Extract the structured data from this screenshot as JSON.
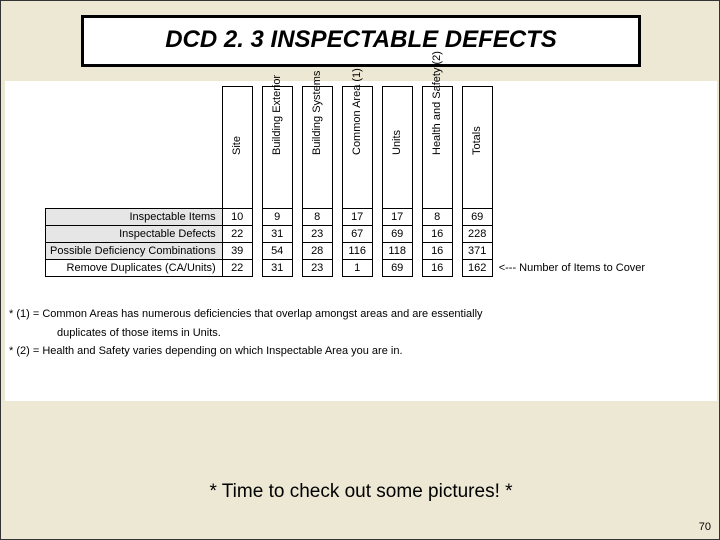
{
  "title": "DCD 2. 3 INSPECTABLE DEFECTS",
  "columns": [
    "Site",
    "Building Exterior",
    "Building Systems",
    "Common Area (1)",
    "Units",
    "Health and Safety (2)"
  ],
  "totals_header": "Totals",
  "rows": [
    {
      "label": "Inspectable Items",
      "bg": "grey",
      "cells": [
        "10",
        "9",
        "8",
        "17",
        "17",
        "8"
      ],
      "total": "69"
    },
    {
      "label": "Inspectable Defects",
      "bg": "grey",
      "cells": [
        "22",
        "31",
        "23",
        "67",
        "69",
        "16"
      ],
      "total": "228"
    },
    {
      "label": "Possible Deficiency Combinations",
      "bg": "grey",
      "cells": [
        "39",
        "54",
        "28",
        "116",
        "118",
        "16"
      ],
      "total": "371"
    },
    {
      "label": "Remove Duplicates (CA/Units)",
      "bg": "white",
      "cells": [
        "22",
        "31",
        "23",
        "1",
        "69",
        "16"
      ],
      "total": "162"
    }
  ],
  "row_annotation": "<--- Number of Items to Cover",
  "footnotes": [
    {
      "prefix": "* (1) =",
      "text": "Common Areas has numerous deficiencies that overlap amongst areas and are essentially",
      "cont": "duplicates of those items in Units."
    },
    {
      "prefix": "* (2) =",
      "text": "Health and Safety varies depending on which Inspectable Area you are in.",
      "cont": ""
    }
  ],
  "callout": "* Time to check out some pictures! *",
  "page_number": "70"
}
